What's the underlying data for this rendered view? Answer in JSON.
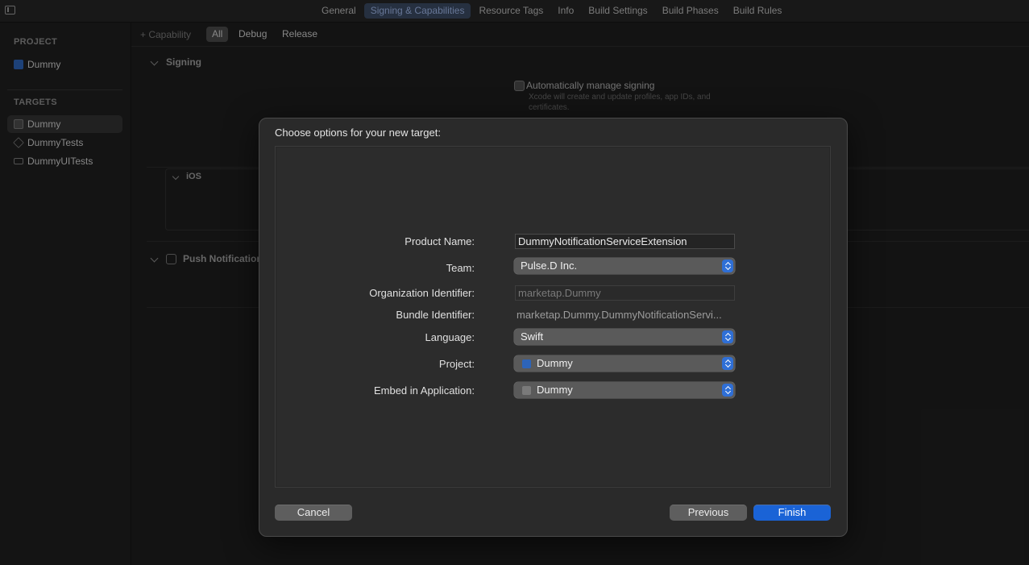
{
  "toolbar": {
    "tabs": [
      "General",
      "Signing & Capabilities",
      "Resource Tags",
      "Info",
      "Build Settings",
      "Build Phases",
      "Build Rules"
    ]
  },
  "sidebar": {
    "project_header": "PROJECT",
    "project_item": "Dummy",
    "targets_header": "TARGETS",
    "targets": [
      "Dummy",
      "DummyTests",
      "DummyUITests"
    ]
  },
  "editor": {
    "add_capability": "+ Capability",
    "filters": [
      "All",
      "Debug",
      "Release"
    ],
    "signing_header": "Signing",
    "auto_manage": "Automatically manage signing",
    "auto_manage_desc_1": "Xcode will create and update profiles, app IDs, and",
    "auto_manage_desc_2": "certificates.",
    "ios_label": "iOS",
    "push_header": "Push Notifications"
  },
  "dialog": {
    "title": "Choose options for your new target:",
    "fields": {
      "product_name_label": "Product Name:",
      "product_name_value": "DummyNotificationServiceExtension",
      "team_label": "Team:",
      "team_value": "Pulse.D Inc.",
      "org_id_label": "Organization Identifier:",
      "org_id_value": "marketap.Dummy",
      "bundle_id_label": "Bundle Identifier:",
      "bundle_id_value": "marketap.Dummy.DummyNotificationServi...",
      "language_label": "Language:",
      "language_value": "Swift",
      "project_label": "Project:",
      "project_value": "Dummy",
      "embed_label": "Embed in Application:",
      "embed_value": "Dummy"
    },
    "buttons": {
      "cancel": "Cancel",
      "previous": "Previous",
      "finish": "Finish"
    }
  },
  "colors": {
    "accent": "#1a63d6",
    "selected_tab_bg": "#3b4a63",
    "window_bg": "#1e1e1e"
  }
}
